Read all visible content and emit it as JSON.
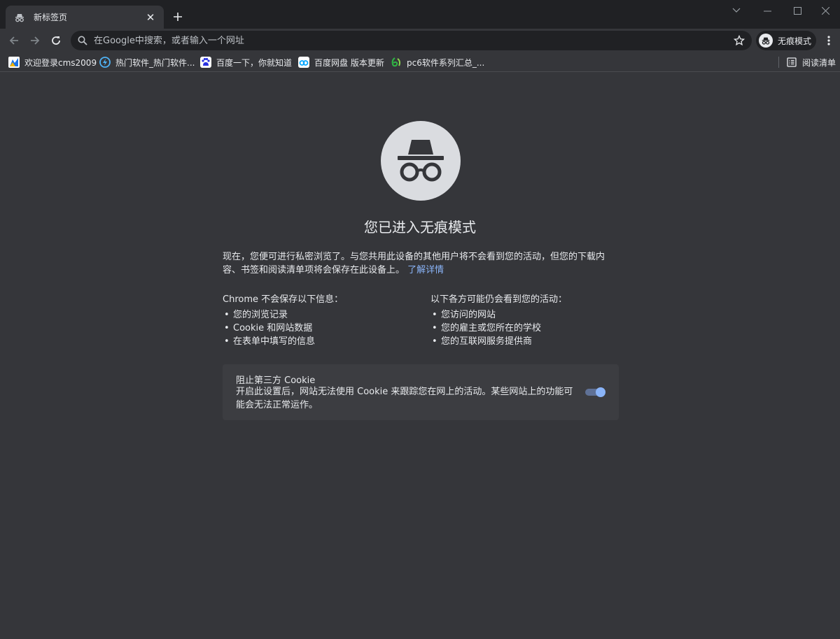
{
  "tab": {
    "title": "新标签页",
    "close_glyph": "✕"
  },
  "toolbar": {
    "omnibox_placeholder": "在Google中搜索，或者输入一个网址",
    "incognito_chip_label": "无痕模式"
  },
  "bookmarks": [
    {
      "label": "欢迎登录cms2009",
      "icon": "cms-favicon",
      "color": "#1a73e8"
    },
    {
      "label": "热门软件_热门软件...",
      "icon": "hot-software-favicon",
      "color": "#4fb3f6"
    },
    {
      "label": "百度一下，你就知道",
      "icon": "baidu-favicon",
      "color": "#2932e1"
    },
    {
      "label": "百度网盘 版本更新",
      "icon": "baidu-netdisk-favicon",
      "color": "#06a7ff"
    },
    {
      "label": "pc6软件系列汇总_...",
      "icon": "pc6-favicon",
      "color": "#2fb344"
    }
  ],
  "reading_list_label": "阅读清单",
  "content": {
    "heading": "您已进入无痕模式",
    "intro": "现在，您便可进行私密浏览了。与您共用此设备的其他用户将不会看到您的活动，但您的下载内容、书签和阅读清单项将会保存在此设备上。",
    "learn_more": "了解详情",
    "left_title": "Chrome 不会保存以下信息：",
    "left_items": [
      "您的浏览记录",
      "Cookie 和网站数据",
      "在表单中填写的信息"
    ],
    "right_title": "以下各方可能仍会看到您的活动：",
    "right_items": [
      "您访问的网站",
      "您的雇主或您所在的学校",
      "您的互联网服务提供商"
    ],
    "cookie_title": "阻止第三方 Cookie",
    "cookie_desc": "开启此设置后，网站无法使用 Cookie 来跟踪您在网上的活动。某些网站上的功能可能会无法正常运作。",
    "cookie_toggle_on": true
  },
  "colors": {
    "accent": "#8ab4f8",
    "background": "#35363a",
    "frame": "#202124"
  }
}
